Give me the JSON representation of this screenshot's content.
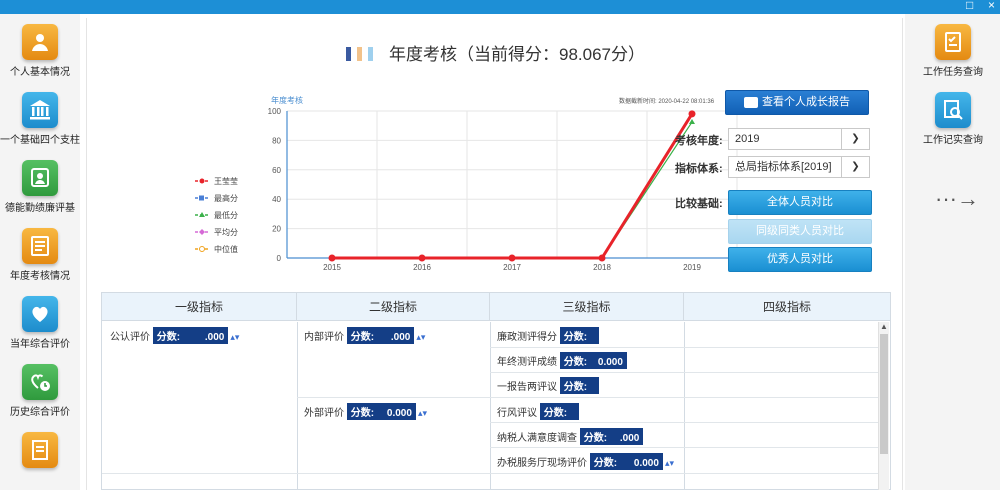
{
  "window": {
    "minimize_glyph": "□",
    "close_glyph": "×"
  },
  "left_nav": [
    {
      "label": "个人基本情况",
      "color": "#f0a31e",
      "icon": "person-icon"
    },
    {
      "label": "一个基础四个支柱",
      "color": "#2a9fd9",
      "icon": "bank-icon"
    },
    {
      "label": "德能勤绩廉评基",
      "color": "#3aa64a",
      "icon": "badge-icon"
    },
    {
      "label": "年度考核情况",
      "color": "#f0a31e",
      "icon": "list-icon"
    },
    {
      "label": "当年综合评价",
      "color": "#2a9fd9",
      "icon": "heart-icon"
    },
    {
      "label": "历史综合评价",
      "color": "#3aa64a",
      "icon": "history-icon"
    },
    {
      "label": "",
      "color": "#f0a31e",
      "icon": "document-icon"
    }
  ],
  "right_nav": [
    {
      "label": "工作任务查询",
      "color": "#f0a31e",
      "icon": "task-icon"
    },
    {
      "label": "工作记实查询",
      "color": "#2a9fd9",
      "icon": "record-search-icon"
    }
  ],
  "right_arrow": "···→",
  "title": "年度考核（当前得分：98.067分）",
  "chart_data": {
    "type": "line",
    "title": "年度考核",
    "timestamp": "数据截新时间: 2020-04-22 08:01:36",
    "xlabel": "年度",
    "categories": [
      "2015",
      "2016",
      "2017",
      "2018",
      "2019"
    ],
    "ylim": [
      0,
      100
    ],
    "yticks": [
      0,
      20,
      40,
      60,
      80,
      100
    ],
    "grid": true,
    "legend_position": "left",
    "series": [
      {
        "name": "王莹莹",
        "color": "#e8232a",
        "marker": "circle",
        "values": [
          0,
          0,
          0,
          0,
          98.067
        ]
      },
      {
        "name": "最高分",
        "color": "#4a7fd6",
        "marker": "square",
        "values": [
          0,
          0,
          0,
          0,
          98.9
        ]
      },
      {
        "name": "最低分",
        "color": "#3bb14a",
        "marker": "triangle",
        "values": [
          0,
          0,
          0,
          0,
          92.5
        ]
      },
      {
        "name": "平均分",
        "color": "#d56ad6",
        "marker": "diamond",
        "values": [
          0,
          0,
          0,
          0,
          97.0
        ]
      },
      {
        "name": "中位值",
        "color": "#f0a31e",
        "marker": "circle-open",
        "values": [
          0,
          0,
          0,
          0,
          97.5
        ]
      }
    ]
  },
  "report_button": "查看个人成长报告",
  "form": {
    "year_label": "考核年度:",
    "year_value": "2019",
    "system_label": "指标体系:",
    "system_value": "总局指标体系[2019]",
    "compare_label": "比较基础:"
  },
  "compare_buttons": {
    "all": "全体人员对比",
    "peer": "同级同类人员对比",
    "excellent": "优秀人员对比"
  },
  "table": {
    "headers": [
      "一级指标",
      "二级指标",
      "三级指标",
      "四级指标"
    ],
    "score_label": "分数:",
    "level1": [
      {
        "name": "公认评价",
        "score": ".000"
      }
    ],
    "level2": [
      {
        "name": "内部评价",
        "score": ".000"
      },
      {
        "name": "外部评价",
        "score": "0.000"
      }
    ],
    "level3": [
      {
        "name": "廉政测评得分",
        "score": ""
      },
      {
        "name": "年终测评成绩",
        "score": "0.000"
      },
      {
        "name": "一报告两评议",
        "score": ""
      },
      {
        "name": "行风评议",
        "score": ""
      },
      {
        "name": "纳税人满意度调查",
        "score": ".000"
      },
      {
        "name": "办税服务厅现场评价",
        "score": "0.000"
      }
    ]
  }
}
